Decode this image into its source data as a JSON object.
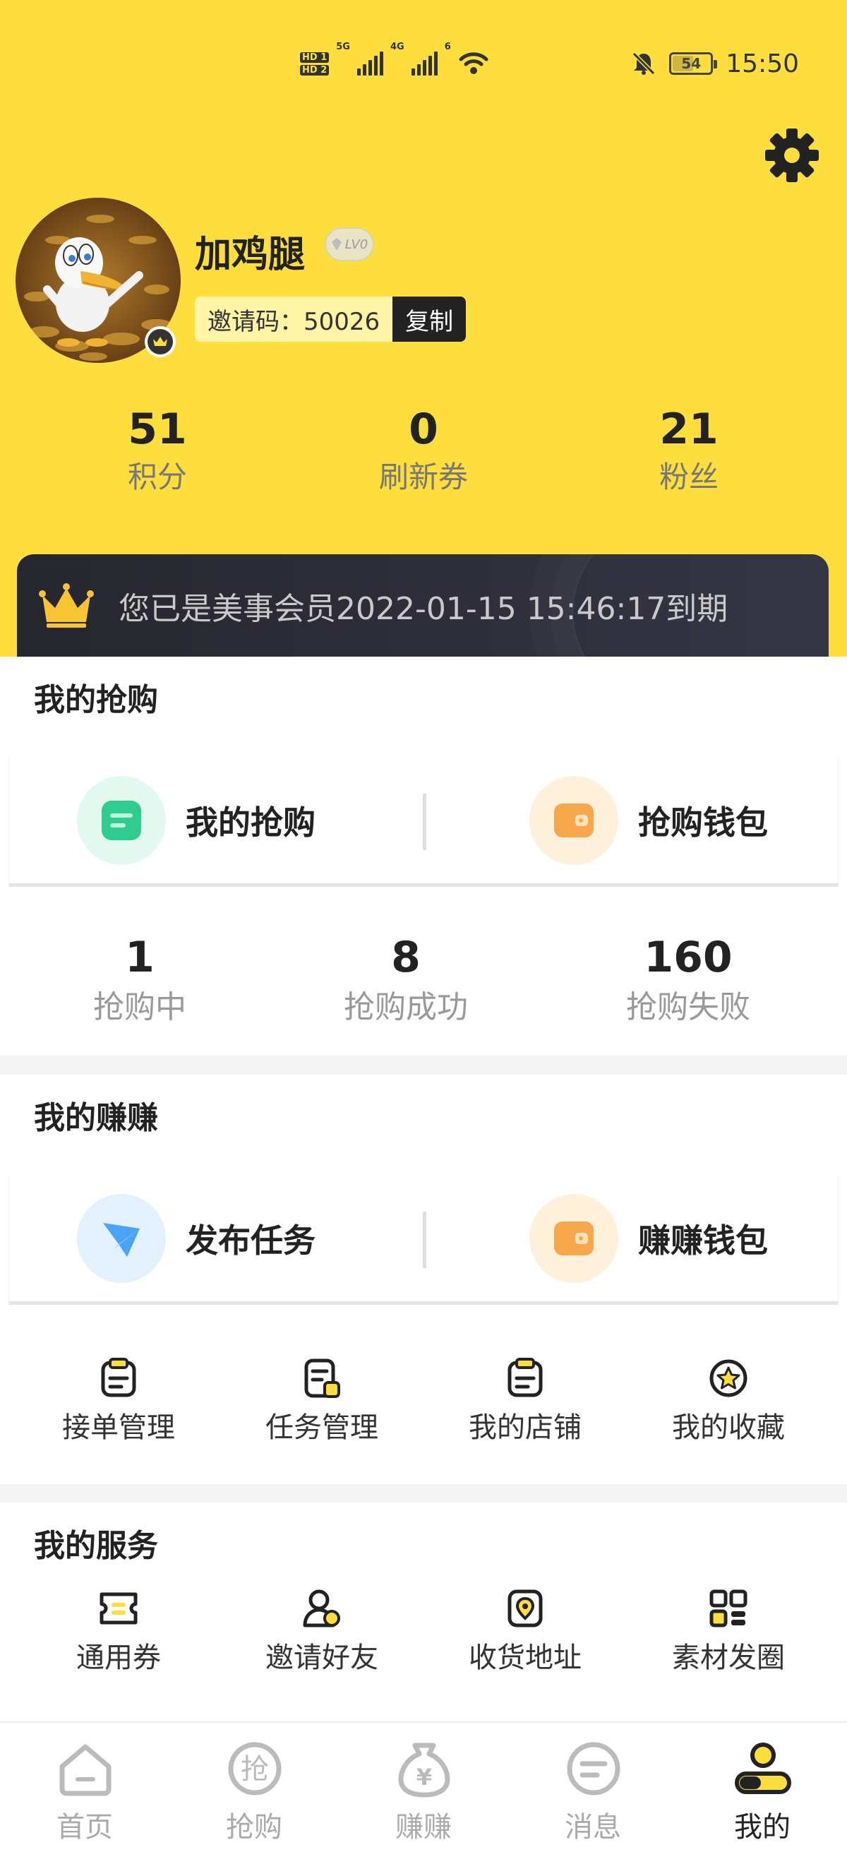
{
  "status_bar": {
    "hd1": "HD 1",
    "hd2": "HD 2",
    "net1": "5G",
    "net2": "4G",
    "wifi": "6",
    "battery": "54",
    "time": "15:50"
  },
  "profile": {
    "username": "加鸡腿",
    "level": "LV0",
    "invite_label": "邀请码：50026",
    "copy_label": "复制"
  },
  "stats": [
    {
      "value": "51",
      "label": "积分"
    },
    {
      "value": "0",
      "label": "刷新券"
    },
    {
      "value": "21",
      "label": "粉丝"
    }
  ],
  "membership": {
    "text": "您已是美事会员2022-01-15 15:46:17到期"
  },
  "rush": {
    "title": "我的抢购",
    "card_left": "我的抢购",
    "card_right": "抢购钱包",
    "counts": [
      {
        "value": "1",
        "label": "抢购中"
      },
      {
        "value": "8",
        "label": "抢购成功"
      },
      {
        "value": "160",
        "label": "抢购失败"
      }
    ]
  },
  "earn": {
    "title": "我的赚赚",
    "card_left": "发布任务",
    "card_right": "赚赚钱包",
    "items": [
      "接单管理",
      "任务管理",
      "我的店铺",
      "我的收藏"
    ]
  },
  "services": {
    "title": "我的服务",
    "items": [
      "通用券",
      "邀请好友",
      "收货地址",
      "素材发圈"
    ]
  },
  "nav": [
    {
      "label": "首页",
      "icon": "home-icon"
    },
    {
      "label": "抢购",
      "icon": "grab-icon"
    },
    {
      "label": "赚赚",
      "icon": "money-bag-icon"
    },
    {
      "label": "消息",
      "icon": "message-icon"
    },
    {
      "label": "我的",
      "icon": "profile-icon"
    }
  ],
  "colors": {
    "brand_yellow": "#FDDE3C",
    "member_dark": "#2b2c36",
    "green_accent": "#2ecc8f",
    "orange_accent": "#f7a84a",
    "blue_accent": "#4aa3f7"
  }
}
